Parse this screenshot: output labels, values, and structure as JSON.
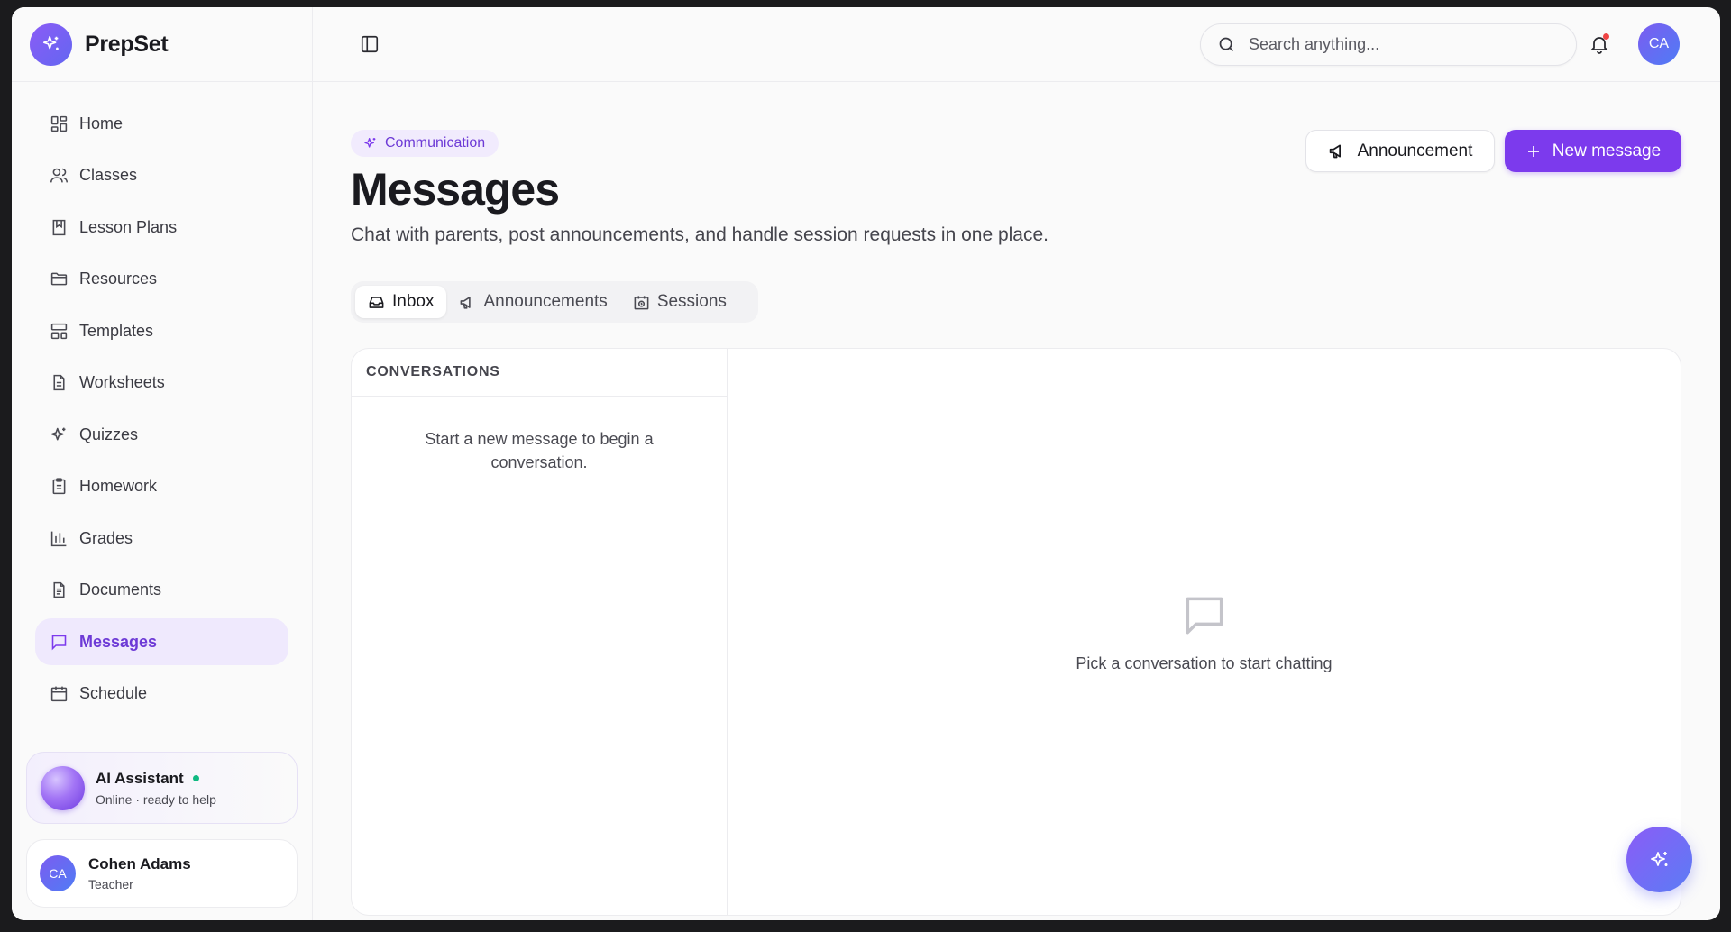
{
  "app": {
    "name": "PrepSet"
  },
  "sidebar": {
    "items": [
      {
        "label": "Home",
        "icon": "home-grid-icon"
      },
      {
        "label": "Classes",
        "icon": "users-icon"
      },
      {
        "label": "Lesson Plans",
        "icon": "bookmark-book-icon"
      },
      {
        "label": "Resources",
        "icon": "folder-icon"
      },
      {
        "label": "Templates",
        "icon": "layout-template-icon"
      },
      {
        "label": "Worksheets",
        "icon": "file-sheet-icon"
      },
      {
        "label": "Quizzes",
        "icon": "sparkles-icon"
      },
      {
        "label": "Homework",
        "icon": "clipboard-icon"
      },
      {
        "label": "Grades",
        "icon": "bar-chart-icon"
      },
      {
        "label": "Documents",
        "icon": "document-icon"
      },
      {
        "label": "Messages",
        "icon": "message-square-icon",
        "active": true
      },
      {
        "label": "Schedule",
        "icon": "calendar-icon"
      }
    ],
    "assistant": {
      "title": "AI Assistant",
      "status": "Online · ready to help"
    },
    "user": {
      "initials": "CA",
      "name": "Cohen Adams",
      "role": "Teacher"
    }
  },
  "topbar": {
    "search_placeholder": "Search anything...",
    "avatar_initials": "CA"
  },
  "page": {
    "badge": "Communication",
    "title": "Messages",
    "subtitle": "Chat with parents, post announcements, and handle session requests in one place.",
    "announcement_button": "Announcement",
    "new_message_button": "New message",
    "tabs": [
      {
        "label": "Inbox",
        "active": true
      },
      {
        "label": "Announcements"
      },
      {
        "label": "Sessions"
      }
    ],
    "conversations_header": "CONVERSATIONS",
    "conversations_empty": "Start a new message to begin a conversation.",
    "chat_empty": "Pick a conversation to start chatting"
  },
  "colors": {
    "accent": "#7c3aed",
    "active_nav_bg": "#efe9fd",
    "online": "#10b981",
    "notification": "#ef4444"
  }
}
